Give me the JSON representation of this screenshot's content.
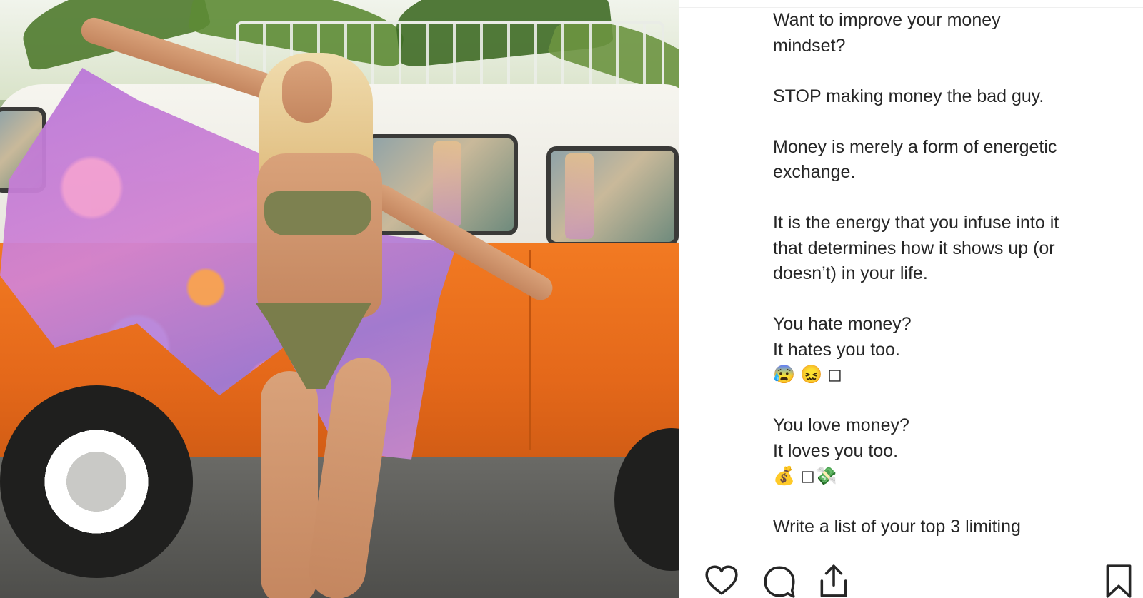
{
  "post": {
    "image_alt": "",
    "caption_lines": [
      "Want to improve your money",
      "mindset?",
      "",
      "STOP making money the bad guy.",
      "",
      "Money is merely a form of energetic",
      "exchange.",
      "",
      "It is the energy that you infuse into it",
      "that determines how it shows up (or",
      "doesn’t) in your life.",
      "",
      "You hate money?",
      "It hates you too.",
      "😰 😖 ◻",
      "",
      "You love money?",
      "It loves you too.",
      "💰 ◻💸",
      "",
      "Write a list of your top 3 limiting"
    ]
  },
  "actions": {
    "like_icon": "heart-icon",
    "comment_icon": "comment-bubble-icon",
    "share_icon": "share-icon",
    "save_icon": "bookmark-icon"
  },
  "colors": {
    "text": "#262626",
    "divider": "#efefef",
    "van_orange": "#e4681a"
  }
}
